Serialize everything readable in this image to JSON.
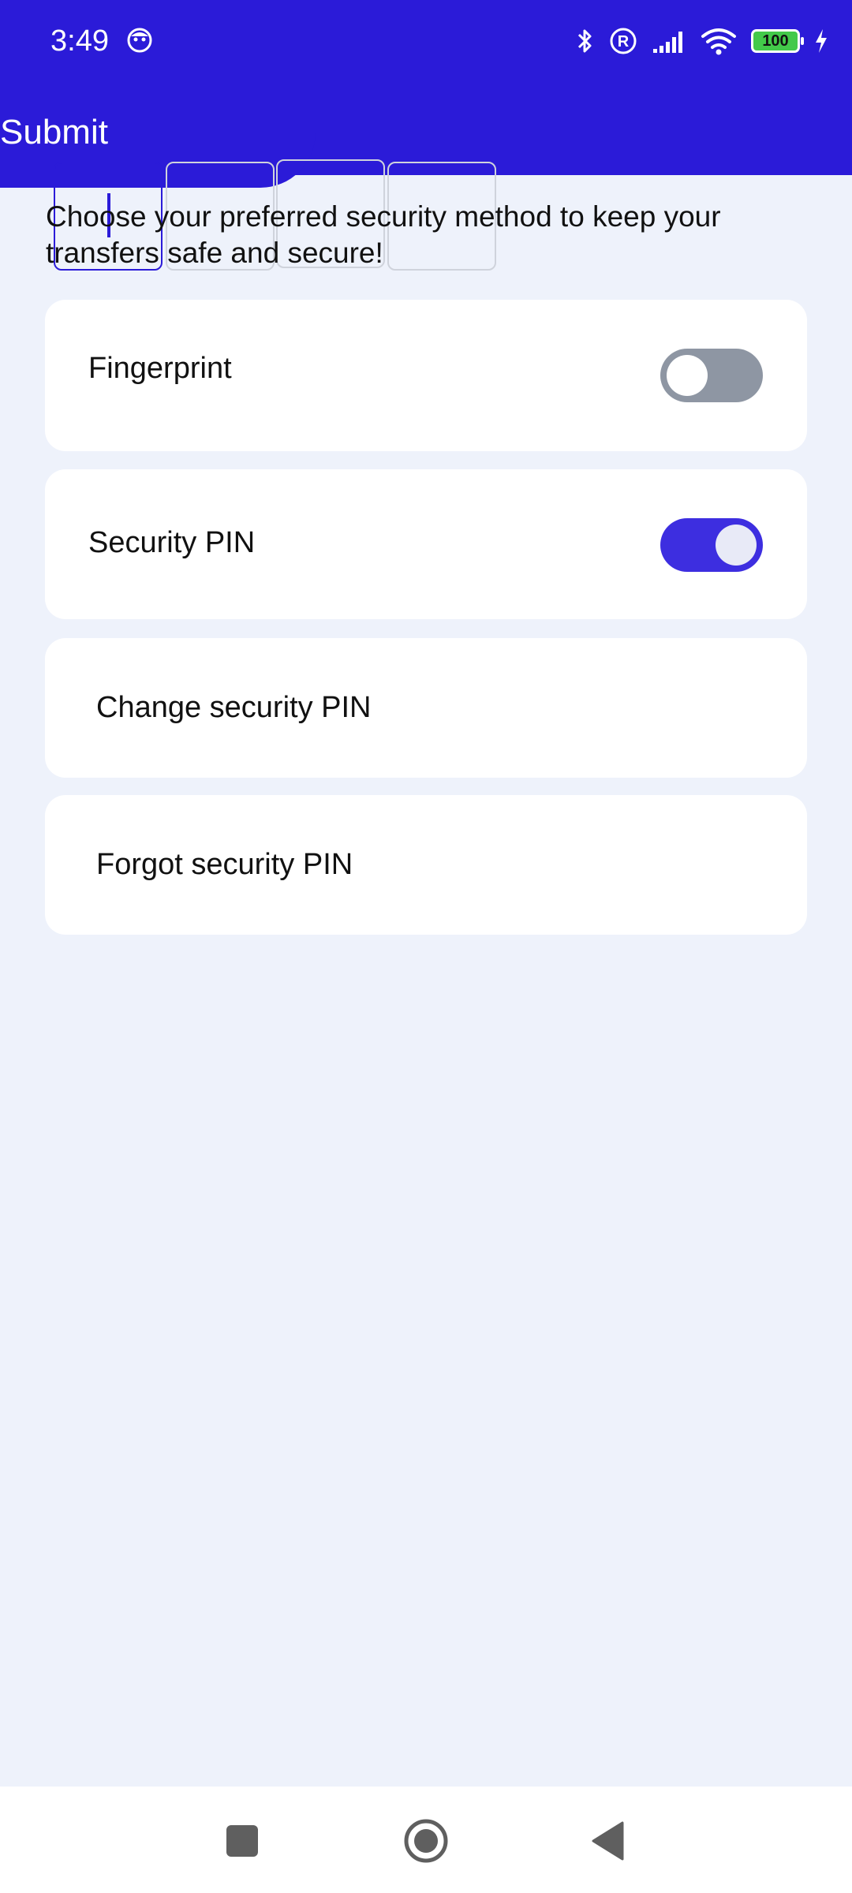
{
  "status_bar": {
    "time": "3:49",
    "battery_level": "100",
    "icons": [
      "bluetooth-icon",
      "registered-icon",
      "signal-icon",
      "wifi-icon",
      "battery-icon",
      "charging-icon"
    ]
  },
  "header": {
    "title": "Submit"
  },
  "pin_input": {
    "boxes": 4,
    "active_index": 0
  },
  "intro_text": "Choose your preferred security method to keep your transfers safe and secure!",
  "settings": {
    "fingerprint": {
      "label": "Fingerprint",
      "enabled": false
    },
    "security_pin": {
      "label": "Security PIN",
      "enabled": true
    },
    "change_pin": {
      "label": "Change security PIN"
    },
    "forgot_pin": {
      "label": "Forgot security PIN"
    }
  },
  "colors": {
    "primary": "#2b1bd8",
    "toggle_on": "#3d2ee0",
    "toggle_off": "#8e96a3",
    "background": "#eef2fb"
  }
}
